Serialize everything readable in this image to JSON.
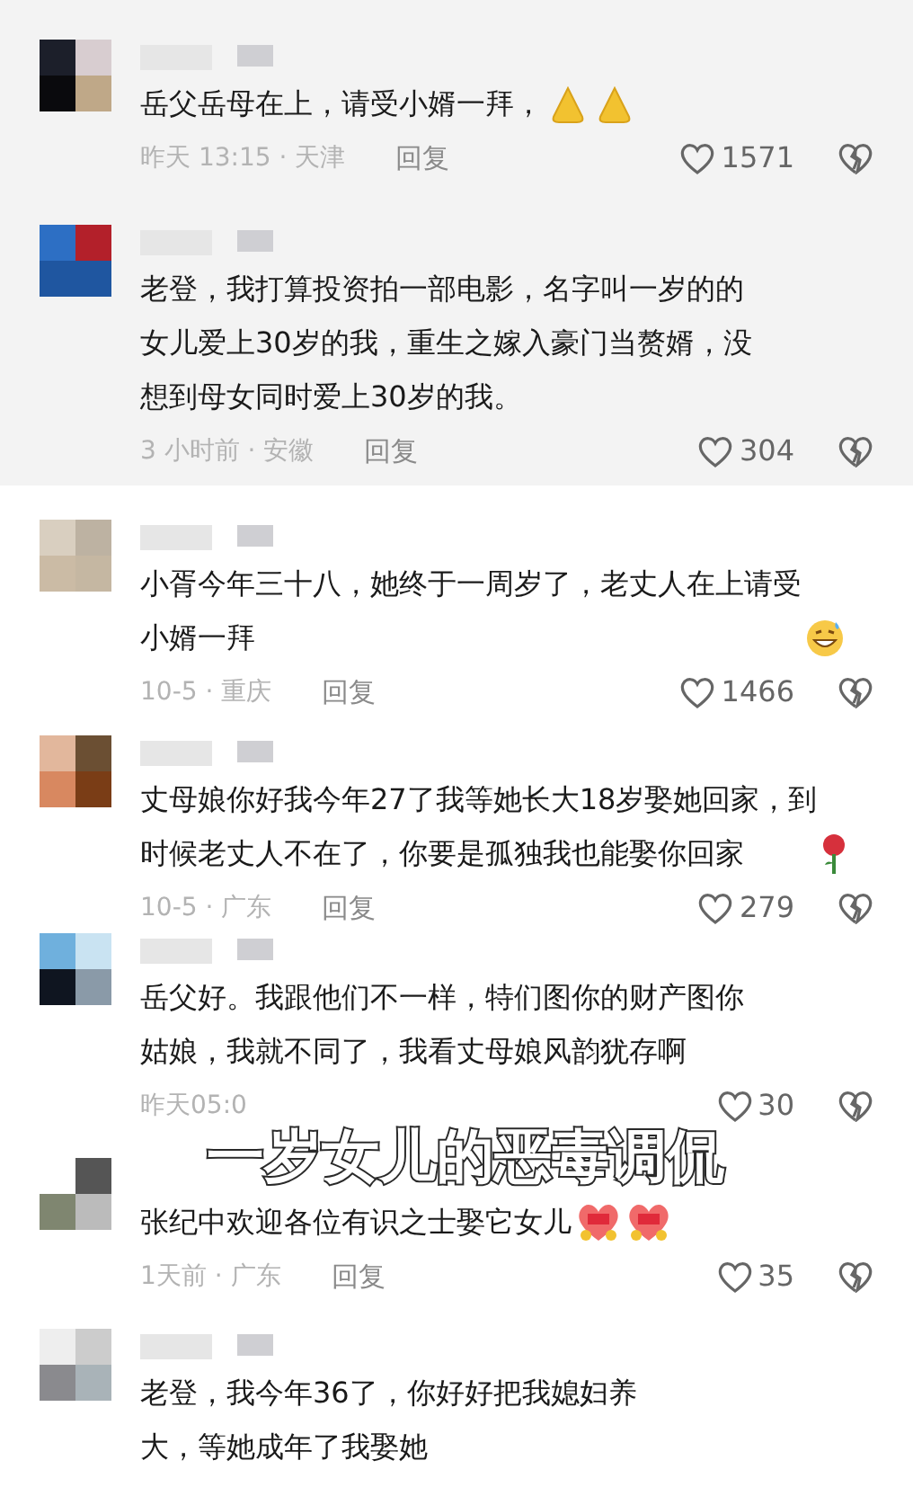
{
  "panels": [
    {
      "comments": [
        {
          "lines": [
            "岳父岳母在上，请受小婿一拜，"
          ],
          "emoji": [
            {
              "kind": "pray"
            },
            {
              "kind": "pray"
            }
          ],
          "time": "昨天 13:15 · 天津",
          "reply": "回复",
          "likes": "1571"
        },
        {
          "lines": [
            "老登，我打算投资拍一部电影，名字叫一岁的的",
            "女儿爱上30岁的我，重生之嫁入豪门当赘婿，没",
            "想到母女同时爱上30岁的我。"
          ],
          "time": "3 小时前 · 安徽",
          "reply": "回复",
          "likes": "304"
        }
      ]
    },
    {
      "comments": [
        {
          "lines": [
            "小胥今年三十八，她终于一周岁了，老丈人在上请受",
            "小婿一拜"
          ],
          "emoji": [
            {
              "kind": "grin"
            }
          ],
          "time": "10-5 · 重庆",
          "reply": "回复",
          "likes": "1466"
        },
        {
          "lines": [
            "丈母娘你好我今年27了我等她长大18岁娶她回家，到",
            "时候老丈人不在了，你要是孤独我也能娶你回家"
          ],
          "emoji": [
            {
              "kind": "rose"
            }
          ],
          "time": "10-5 · 广东",
          "reply": "回复",
          "likes": "279"
        },
        {
          "lines": [
            "岳父好。我跟他们不一样，特们图你的财产图你",
            "姑娘，我就不同了，我看丈母娘风韵犹存啊"
          ],
          "time": "昨天05:0",
          "likes": "30"
        },
        {
          "lines": [
            "张纪中欢迎各位有识之士娶它女儿"
          ],
          "emoji": [
            {
              "kind": "heart"
            },
            {
              "kind": "heart"
            }
          ],
          "time": "1天前 · 广东",
          "reply": "回复",
          "likes": "35"
        },
        {
          "lines": [
            "老登，我今年36了，你好好把我媳妇养",
            "大，等她成年了我娶她"
          ]
        }
      ]
    }
  ],
  "overlay": "一岁女儿的恶毒调侃"
}
